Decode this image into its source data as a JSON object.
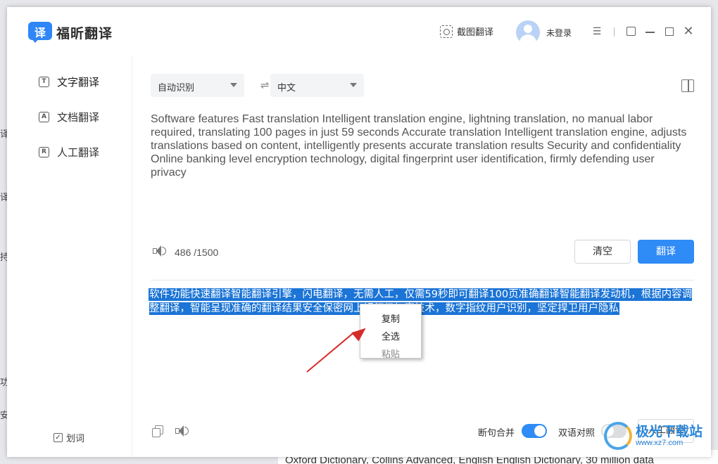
{
  "background": {
    "edge_fragments": [
      "译，",
      "译",
      "持",
      "功",
      "安"
    ],
    "bottom_strip": "Oxford Dictionary, Collins Advanced, English English Dictionary, 30 million data"
  },
  "app": {
    "logo_glyph": "译",
    "name": "福昕翻译",
    "brand_color": "#2f86f6"
  },
  "titlebar": {
    "screenshot_translate": "截图翻译",
    "user_status": "未登录",
    "controls": [
      "menu-icon",
      "pin-icon",
      "minimize-icon",
      "maximize-icon",
      "close-icon"
    ]
  },
  "sidebar": {
    "items": [
      {
        "icon": "T",
        "label": "文字翻译",
        "active": true
      },
      {
        "icon": "A",
        "label": "文档翻译",
        "active": false
      },
      {
        "icon": "R",
        "label": "人工翻译",
        "active": false
      }
    ],
    "word_pick": {
      "check": "✓",
      "label": "划词",
      "checked": true
    }
  },
  "translator": {
    "source_lang": "自动识别",
    "swap_glyph": "⇌",
    "target_lang": "中文",
    "source_text": "Software features    Fast translation    Intelligent translation engine, lightning translation, no manual labor required, translating 100 pages in just 59 seconds    Accurate translation    Intelligent translation engine, adjusts translations based on content, intelligently presents accurate translation results    Security and confidentiality    Online banking level encryption technology, digital fingerprint user identification, firmly defending user privacy",
    "char_count": "486 /1500",
    "clear_label": "清空",
    "translate_label": "翻译",
    "result_text": "软件功能快速翻译智能翻译引擎，闪电翻译，无需人工，仅需59秒即可翻译100页准确翻译智能翻译发动机，根据内容调整翻译，智能呈现准确的翻译结果安全保密网上银行级加密技术，数字指纹用户识别，坚定捍卫用户隐私",
    "sentence_merge_label": "断句合并",
    "sentence_merge_on": true,
    "bilingual_label": "双语对照",
    "bilingual_on": false,
    "human_translate_label": "人工翻译",
    "accent_color": "#2f8bf5",
    "selection_color": "#1b74d6"
  },
  "context_menu": {
    "items": [
      {
        "label": "复制",
        "enabled": true
      },
      {
        "label": "全选",
        "enabled": true
      },
      {
        "label": "粘贴",
        "enabled": false
      }
    ]
  },
  "watermark": {
    "title": "极光下载站",
    "url": "www.xz7.com"
  }
}
